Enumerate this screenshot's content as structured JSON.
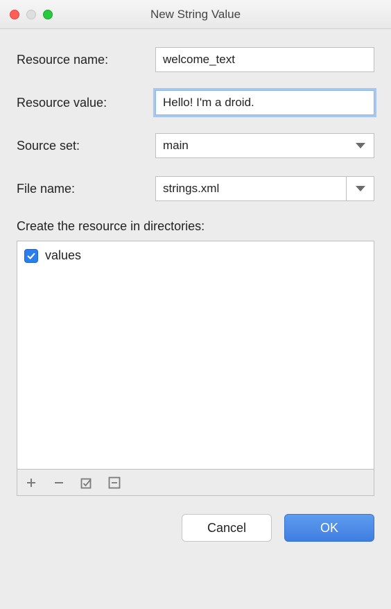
{
  "window": {
    "title": "New String Value"
  },
  "form": {
    "resource_name": {
      "label": "Resource name:",
      "value": "welcome_text"
    },
    "resource_value": {
      "label": "Resource value:",
      "value": "Hello! I'm a droid."
    },
    "source_set": {
      "label": "Source set:",
      "value": "main"
    },
    "file_name": {
      "label": "File name:",
      "value": "strings.xml"
    }
  },
  "directories": {
    "label": "Create the resource in directories:",
    "items": [
      {
        "label": "values",
        "checked": true
      }
    ]
  },
  "buttons": {
    "cancel": "Cancel",
    "ok": "OK"
  }
}
